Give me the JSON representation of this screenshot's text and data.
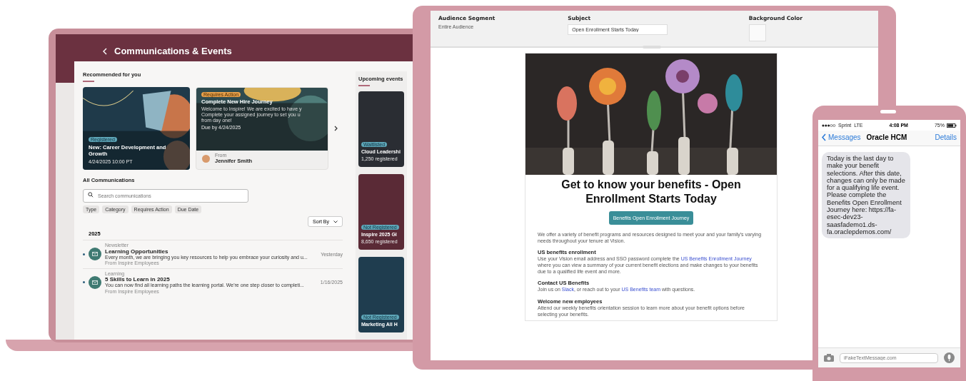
{
  "laptop": {
    "title": "Communications & Events",
    "recommended": {
      "heading": "Recommended for you",
      "cards": [
        {
          "kind": "event",
          "badge": "Registered",
          "title": "New: Career Development and Growth",
          "date": "4/24/2025 10:00 PT"
        },
        {
          "kind": "journey",
          "badge": "Requires Action",
          "title": "Complete New Hire Journey",
          "description_lines": [
            "Welcome to Inspire! We are excited to have y",
            "Complete your assigned journey to set you u",
            "from day one!"
          ],
          "due": "Due by 4/24/2025",
          "from_label": "From",
          "from_name": "Jennifer Smith"
        }
      ]
    },
    "all_communications": {
      "heading": "All Communications",
      "search": {
        "placeholder": "Search communications"
      },
      "filters": [
        "Type",
        "Category",
        "Requires Action",
        "Due Date"
      ],
      "sort_button": "Sort By",
      "year": "2025",
      "items": [
        {
          "category": "Newsletter",
          "title": "Learning Opportunities",
          "preview": "Every month, we are bringing you key resources to help you embrace your curiosity and u...",
          "sender": "From Inspire Employees",
          "date": "Yesterday",
          "unread": true
        },
        {
          "category": "Learning",
          "title": "5 Skills to Learn in 2025",
          "preview": "You can now find all learning paths the learning portal. We're one step closer to completi...",
          "sender": "From Inspire Employees",
          "date": "1/16/2025",
          "unread": true
        }
      ]
    },
    "upcoming_events": {
      "heading": "Upcoming events",
      "events": [
        {
          "badge": "Waitlisted",
          "title": "Cloud Leadershi",
          "attendees": "1,250 registered",
          "color": "#2a2d33"
        },
        {
          "badge": "Not Registered",
          "title": "Inspire 2025 Gl",
          "attendees": "8,650 registered",
          "color": "#5a2a36"
        },
        {
          "badge": "Not Registered",
          "title": "Marketing All H",
          "color": "#1f3d4f"
        }
      ]
    }
  },
  "tablet": {
    "audience_segment": {
      "label": "Audience Segment",
      "value": "Entire Audience"
    },
    "subject": {
      "label": "Subject",
      "value": "Open Enrollment Starts Today"
    },
    "background_color": {
      "label": "Background Color"
    },
    "email": {
      "headline": "Get to know your benefits - Open Enrollment Starts Today",
      "button": "Benefits Open Enrollment Journey",
      "intro": "We offer a variety of benefit programs and resources designed to meet your and your family's varying needs throughout your tenure at Vision.",
      "sections": [
        {
          "heading": "US benefits enrollment",
          "body": [
            {
              "text": "Use your Vision email address and SSO password complete the ",
              "link": false
            },
            {
              "text": "US Benefits Enrollment Journey",
              "link": true
            },
            {
              "text": " where you can view a summary of your current benefit elections and make changes to your benefits due to a qualified life event and more.",
              "link": false
            }
          ]
        },
        {
          "heading": "Contact US Benefits",
          "body": [
            {
              "text": "Join us on ",
              "link": false
            },
            {
              "text": "Slack",
              "link": true
            },
            {
              "text": ", or reach out to your ",
              "link": false
            },
            {
              "text": "US Benefits team",
              "link": true
            },
            {
              "text": " with questions.",
              "link": false
            }
          ]
        },
        {
          "heading": "Welcome new employees",
          "body": [
            {
              "text": "Attend our weekly benefits orientation session to learn more about your benefit options before selecting your benefits.",
              "link": false
            }
          ]
        }
      ]
    }
  },
  "phone": {
    "status": {
      "carrier": "Sprint  LTE",
      "time": "4:08 PM",
      "battery": "75%"
    },
    "nav": {
      "back": "Messages",
      "title": "Oracle HCM",
      "action": "Details"
    },
    "messages": [
      {
        "text": "Today is the last day to make your benefit selections. After this date, changes can only be made for a qualifying life event. Please complete the Benefits Open Enrollment Journey here: https://fa-esec-dev23-saasfademo1.ds-fa.oraclepdemos.com/",
        "incoming": true
      }
    ],
    "input": {
      "placeholder": "iFakeTextMessage.com"
    }
  }
}
